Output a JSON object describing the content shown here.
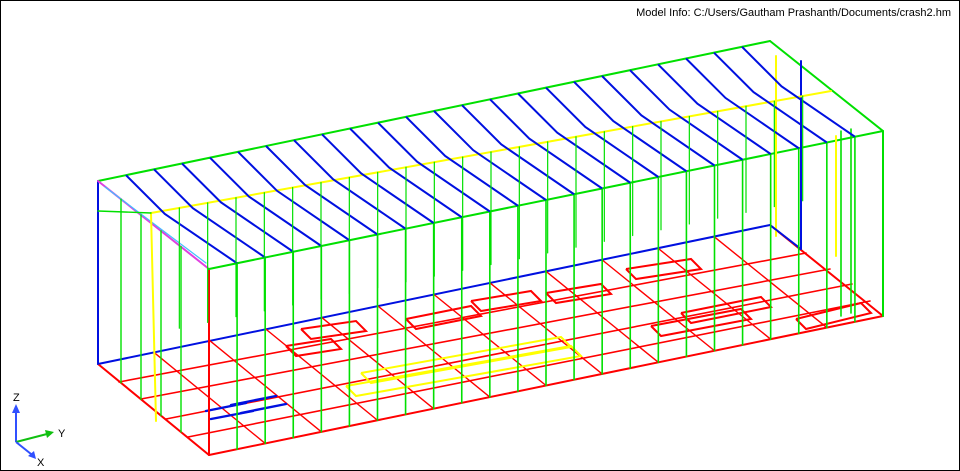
{
  "model_info": "Model Info: C:/Users/Gautham Prashanth/Documents/crash2.hm",
  "triad": {
    "z_label": "Z",
    "y_label": "Y",
    "x_label": "X"
  },
  "colors": {
    "background": "#ffffff",
    "green": "#00e000",
    "blue": "#0010e0",
    "red": "#ff0000",
    "yellow": "#ffff00",
    "magenta": "#e040e0",
    "cyan": "#40c0ff",
    "triad_z": "#3050ff",
    "triad_y": "#10c010",
    "triad_x": "#3050ff"
  }
}
